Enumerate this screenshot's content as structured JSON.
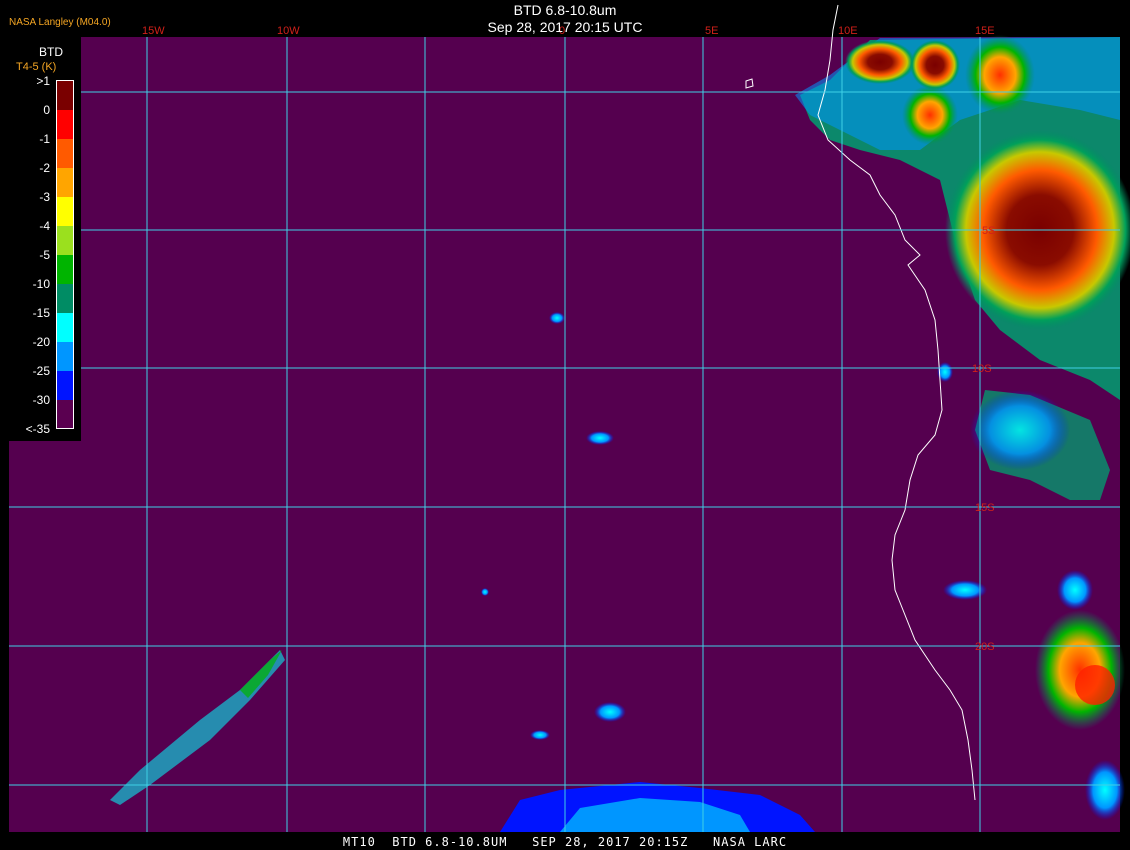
{
  "header": {
    "title": "BTD 6.8-10.8um",
    "datetime": "Sep 28, 2017 20:15 UTC",
    "credit": "NASA Langley (M04.0)"
  },
  "footer": {
    "text": "MT10  BTD 6.8-10.8UM   SEP 28, 2017 20:15Z   NASA LARC"
  },
  "legend": {
    "title": "BTD",
    "subtitle": "T4-5 (K)",
    "entries": [
      {
        "label": ">1",
        "color": "#7a0000"
      },
      {
        "label": "0",
        "color": "#ff0000"
      },
      {
        "label": "-1",
        "color": "#ff5a00"
      },
      {
        "label": "-2",
        "color": "#ffa500"
      },
      {
        "label": "-3",
        "color": "#ffff00"
      },
      {
        "label": "-4",
        "color": "#9be01e"
      },
      {
        "label": "-5",
        "color": "#00b400"
      },
      {
        "label": "-10",
        "color": "#008c64"
      },
      {
        "label": "-15",
        "color": "#00ffff"
      },
      {
        "label": "-20",
        "color": "#0096ff"
      },
      {
        "label": "-25",
        "color": "#0014ff"
      },
      {
        "label": "-30",
        "color": "#5a0050"
      },
      {
        "label": "<-35",
        "color": "#5a0050"
      }
    ]
  },
  "map": {
    "background_color": "#55004f",
    "grid_color": "#3fd0e6",
    "lon_label_color": "#d0201a",
    "lat_label_color": "#d0201a",
    "longitude_labels": [
      "15W",
      "10W",
      "0",
      "5E",
      "10E",
      "15E"
    ],
    "latitude_labels": [
      "5S",
      "10S",
      "15S",
      "20S"
    ]
  }
}
